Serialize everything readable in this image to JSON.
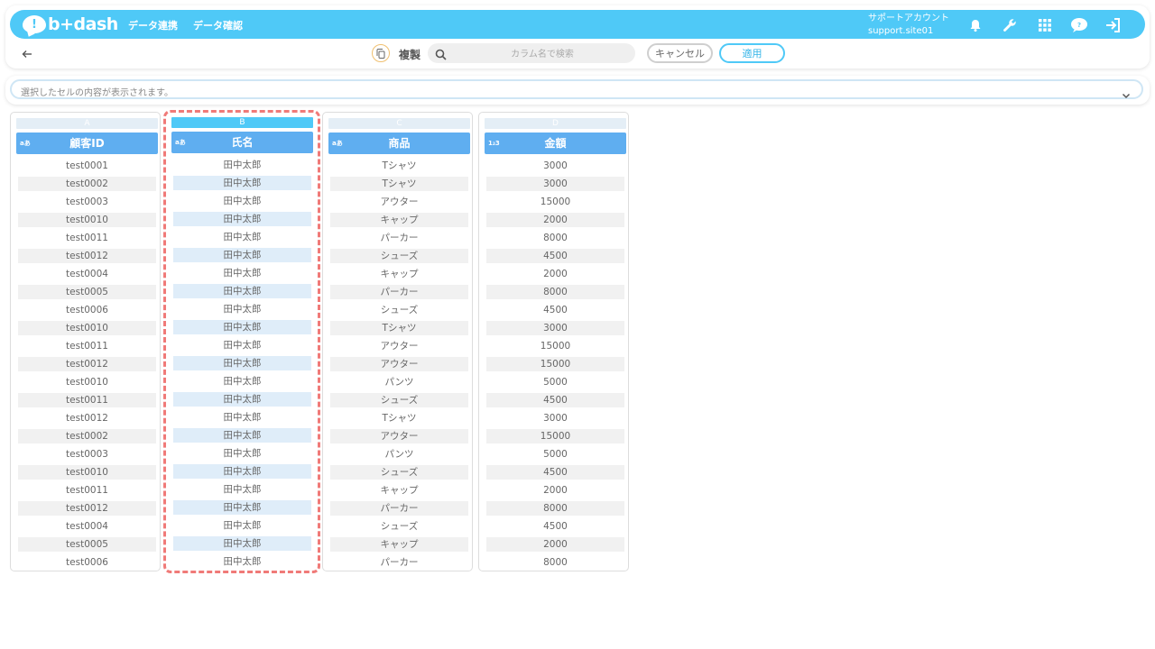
{
  "navbar": {
    "logo": "b+dash",
    "links": [
      "データ連携",
      "データ確認"
    ],
    "account_name": "サポートアカウント",
    "account_site": "support.site01",
    "icons": [
      "bell-icon",
      "wrench-icon",
      "grid-icon",
      "help-icon",
      "logout-icon"
    ],
    "accent_color": "#4fc9f7"
  },
  "toolbar": {
    "title": "複製",
    "search_placeholder": "カラム名で検索",
    "cancel_label": "キャンセル",
    "apply_label": "適用"
  },
  "cellbar": {
    "placeholder": "選択したセルの内容が表示されます。"
  },
  "columns": [
    {
      "letter": "A",
      "type": "aあ",
      "header": "顧客ID",
      "selected": false,
      "cells": [
        "test0001",
        "test0002",
        "test0003",
        "test0010",
        "test0011",
        "test0012",
        "test0004",
        "test0005",
        "test0006",
        "test0010",
        "test0011",
        "test0012",
        "test0010",
        "test0011",
        "test0012",
        "test0002",
        "test0003",
        "test0010",
        "test0011",
        "test0012",
        "test0004",
        "test0005",
        "test0006"
      ]
    },
    {
      "letter": "B",
      "type": "aあ",
      "header": "氏名",
      "selected": true,
      "cells": [
        "田中太郎",
        "田中太郎",
        "田中太郎",
        "田中太郎",
        "田中太郎",
        "田中太郎",
        "田中太郎",
        "田中太郎",
        "田中太郎",
        "田中太郎",
        "田中太郎",
        "田中太郎",
        "田中太郎",
        "田中太郎",
        "田中太郎",
        "田中太郎",
        "田中太郎",
        "田中太郎",
        "田中太郎",
        "田中太郎",
        "田中太郎",
        "田中太郎",
        "田中太郎"
      ]
    },
    {
      "letter": "C",
      "type": "aあ",
      "header": "商品",
      "selected": false,
      "cells": [
        "Tシャツ",
        "Tシャツ",
        "アウター",
        "キャップ",
        "パーカー",
        "シューズ",
        "キャップ",
        "パーカー",
        "シューズ",
        "Tシャツ",
        "アウター",
        "アウター",
        "パンツ",
        "シューズ",
        "Tシャツ",
        "アウター",
        "パンツ",
        "シューズ",
        "キャップ",
        "パーカー",
        "シューズ",
        "キャップ",
        "パーカー"
      ]
    },
    {
      "letter": "D",
      "type": "1₂3",
      "header": "金額",
      "selected": false,
      "cells": [
        "3000",
        "3000",
        "15000",
        "2000",
        "8000",
        "4500",
        "2000",
        "8000",
        "4500",
        "3000",
        "15000",
        "15000",
        "5000",
        "4500",
        "3000",
        "15000",
        "5000",
        "4500",
        "2000",
        "8000",
        "4500",
        "2000",
        "8000"
      ]
    }
  ]
}
